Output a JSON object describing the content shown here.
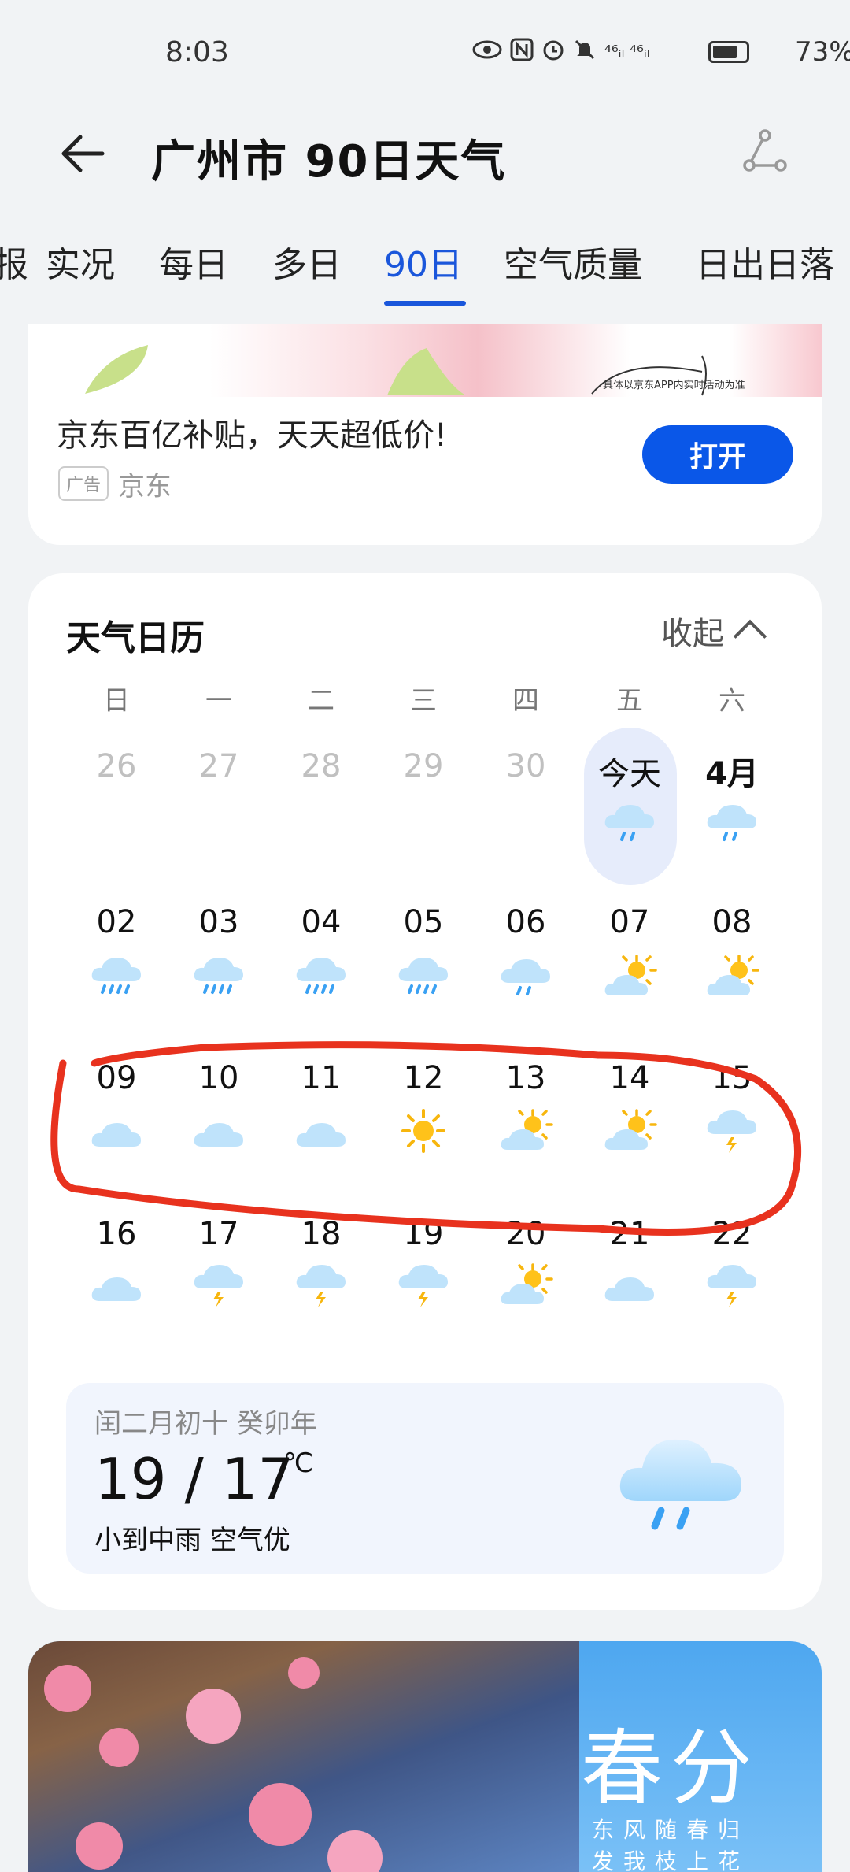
{
  "status_bar": {
    "time": "8:03",
    "signal_text": "⁴⁶ᵢₗ ⁴⁶ᵢₗ",
    "battery": "73%"
  },
  "header": {
    "title": "广州市 90日天气"
  },
  "tabs": [
    {
      "label": "报"
    },
    {
      "label": "实况"
    },
    {
      "label": "每日"
    },
    {
      "label": "多日"
    },
    {
      "label": "90日",
      "active": true
    },
    {
      "label": "空气质量"
    },
    {
      "label": "日出日落"
    }
  ],
  "ad": {
    "title": "京东百亿补贴，天天超低价!",
    "tag": "广告",
    "brand": "京东",
    "button": "打开",
    "fine_print": "具体以京东APP内实时活动为准"
  },
  "calendar": {
    "title": "天气日历",
    "collapse_label": "收起",
    "weekdays": [
      "日",
      "一",
      "二",
      "三",
      "四",
      "五",
      "六"
    ],
    "rows": [
      [
        {
          "label": "26",
          "style": "dim",
          "icon": ""
        },
        {
          "label": "27",
          "style": "dim",
          "icon": ""
        },
        {
          "label": "28",
          "style": "dim",
          "icon": ""
        },
        {
          "label": "29",
          "style": "dim",
          "icon": ""
        },
        {
          "label": "30",
          "style": "dim",
          "icon": ""
        },
        {
          "label": "今天",
          "style": "today",
          "icon": "light-rain-icon"
        },
        {
          "label": "4月",
          "style": "bold",
          "icon": "light-rain-icon"
        }
      ],
      [
        {
          "label": "02",
          "style": "normal",
          "icon": "heavy-rain-icon"
        },
        {
          "label": "03",
          "style": "normal",
          "icon": "heavy-rain-icon"
        },
        {
          "label": "04",
          "style": "normal",
          "icon": "heavy-rain-icon"
        },
        {
          "label": "05",
          "style": "normal",
          "icon": "heavy-rain-icon"
        },
        {
          "label": "06",
          "style": "normal",
          "icon": "light-rain-icon"
        },
        {
          "label": "07",
          "style": "normal",
          "icon": "partly-cloudy-icon"
        },
        {
          "label": "08",
          "style": "normal",
          "icon": "partly-cloudy-icon"
        }
      ],
      [
        {
          "label": "09",
          "style": "normal",
          "icon": "cloudy-icon"
        },
        {
          "label": "10",
          "style": "normal",
          "icon": "cloudy-icon"
        },
        {
          "label": "11",
          "style": "normal",
          "icon": "cloudy-icon"
        },
        {
          "label": "12",
          "style": "normal",
          "icon": "sunny-icon"
        },
        {
          "label": "13",
          "style": "normal",
          "icon": "partly-cloudy-icon"
        },
        {
          "label": "14",
          "style": "normal",
          "icon": "partly-cloudy-icon"
        },
        {
          "label": "15",
          "style": "normal",
          "icon": "thunder-shower-icon"
        }
      ],
      [
        {
          "label": "16",
          "style": "normal",
          "icon": "cloudy-icon"
        },
        {
          "label": "17",
          "style": "normal",
          "icon": "thunder-shower-icon"
        },
        {
          "label": "18",
          "style": "normal",
          "icon": "thunder-shower-icon"
        },
        {
          "label": "19",
          "style": "normal",
          "icon": "thunder-shower-icon"
        },
        {
          "label": "20",
          "style": "normal",
          "icon": "partly-cloudy-icon"
        },
        {
          "label": "21",
          "style": "normal",
          "icon": "cloudy-icon"
        },
        {
          "label": "22",
          "style": "normal",
          "icon": "thunder-shower-icon"
        }
      ]
    ]
  },
  "today_info": {
    "lunar": "闰二月初十 癸卯年",
    "temp": "19 / 17",
    "unit": "℃",
    "desc": "小到中雨 空气优"
  },
  "banner": {
    "title": "春分",
    "line1": "东风随春归",
    "line2": "发我枝上花"
  },
  "colors": {
    "accent": "#1a56db",
    "button": "#0a57e8",
    "annotation": "#e8321e"
  }
}
